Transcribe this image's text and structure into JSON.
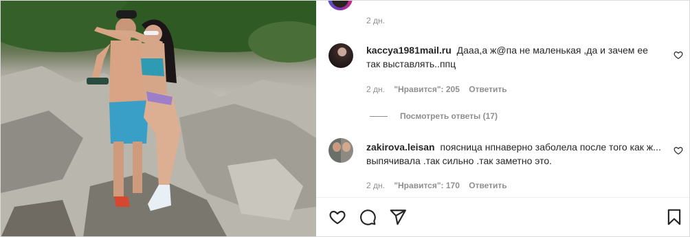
{
  "post": {
    "top_time": "2 дн."
  },
  "comments": [
    {
      "username": "kaccya1981mail.ru",
      "text": "Дааа,а ж@па не маленькая ,да и зачем ее так выставлять..ппц",
      "time": "2 дн.",
      "likes": "\"Нравится\": 205",
      "reply_label": "Ответить",
      "view_replies": "Посмотреть ответы (17)"
    },
    {
      "username": "zakirova.leisan",
      "text": "поясница нпнаверно заболела после того как ж... выпячивала .так сильно .так заметно это.",
      "time": "2 дн.",
      "likes": "\"Нравится\": 170",
      "reply_label": "Ответить"
    }
  ],
  "icons": {
    "like": "heart-icon",
    "comment": "comment-icon",
    "share": "share-icon",
    "save": "bookmark-icon"
  }
}
